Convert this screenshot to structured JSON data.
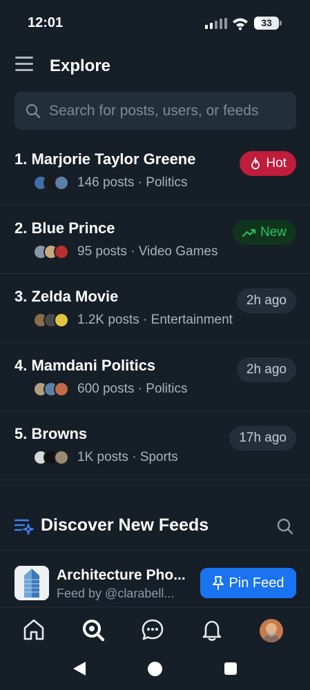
{
  "status_bar": {
    "time": "12:01",
    "battery": "33"
  },
  "header": {
    "title": "Explore"
  },
  "search": {
    "placeholder": "Search for posts, users, or feeds"
  },
  "trending": [
    {
      "title": "1. Marjorie Taylor Greene",
      "meta": "146 posts · Politics",
      "badge": "Hot",
      "badge_type": "hot",
      "avatar_colors": [
        "#3f6fa8",
        "#1b1b1b",
        "#5b7fa6"
      ]
    },
    {
      "title": "2. Blue Prince",
      "meta": "95 posts · Video Games",
      "badge": "New",
      "badge_type": "new",
      "avatar_colors": [
        "#8a96a8",
        "#c9a77c",
        "#b9312e"
      ]
    },
    {
      "title": "3. Zelda Movie",
      "meta": "1.2K posts · Entertainment",
      "badge": "2h ago",
      "badge_type": "ago",
      "avatar_colors": [
        "#8b6b4a",
        "#4a4a4a",
        "#e2c440"
      ]
    },
    {
      "title": "4. Mamdani Politics",
      "meta": "600 posts · Politics",
      "badge": "2h ago",
      "badge_type": "ago",
      "avatar_colors": [
        "#b2a07d",
        "#5e7fa3",
        "#c46a4a"
      ]
    },
    {
      "title": "5. Browns",
      "meta": "1K posts · Sports",
      "badge": "17h ago",
      "badge_type": "ago",
      "avatar_colors": [
        "#d8d8d8",
        "#111111",
        "#9c8a70"
      ]
    }
  ],
  "discover": {
    "title": "Discover New Feeds"
  },
  "feed": {
    "name": "Architecture Pho...",
    "by": "Feed by @clarabell...",
    "pin_label": "Pin Feed"
  }
}
